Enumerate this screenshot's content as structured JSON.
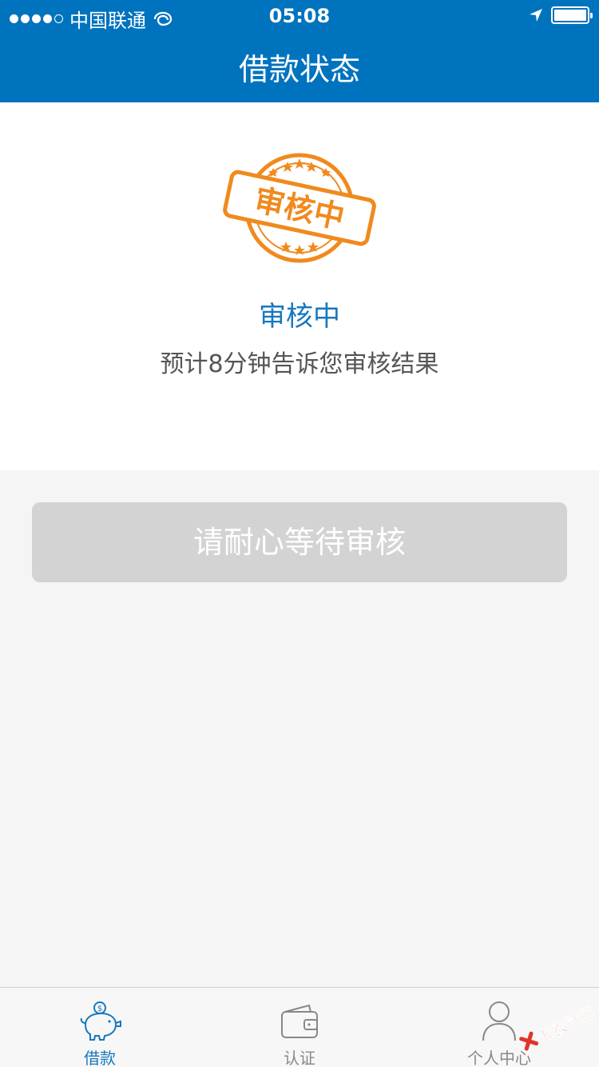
{
  "status_bar": {
    "carrier": "中国联通",
    "time": "05:08"
  },
  "header": {
    "title": "借款状态"
  },
  "status": {
    "stamp_text": "审核中",
    "title": "审核中",
    "description": "预计8分钟告诉您审核结果"
  },
  "action": {
    "button_label": "请耐心等待审核"
  },
  "tabbar": {
    "items": [
      {
        "label": "借款",
        "icon": "piggy-bank-icon",
        "active": true
      },
      {
        "label": "认证",
        "icon": "wallet-icon",
        "active": false
      },
      {
        "label": "个人中心",
        "icon": "user-icon",
        "active": false
      }
    ]
  },
  "watermark": {
    "text": "卡农社区"
  },
  "colors": {
    "brand_blue": "#0073bf",
    "accent_blue": "#1778bd",
    "stamp_orange": "#f08a1d",
    "disabled_button": "#d3d3d3"
  }
}
